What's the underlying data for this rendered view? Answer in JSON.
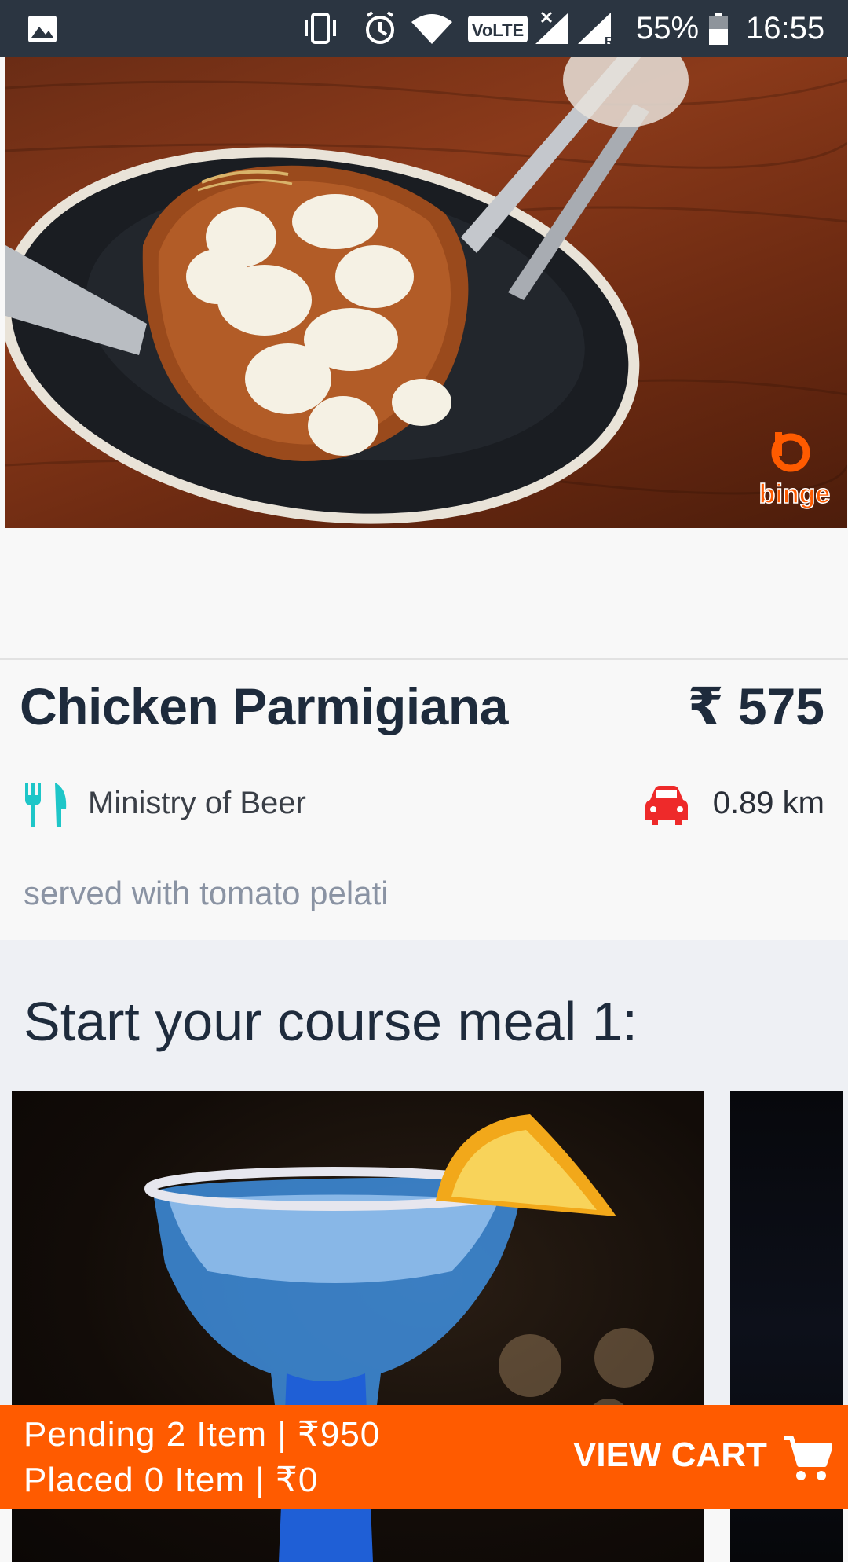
{
  "status_bar": {
    "battery_percent": "55%",
    "time": "16:55",
    "network_label": "VoLTE",
    "icons": [
      "gallery-icon",
      "vibrate-icon",
      "alarm-icon",
      "wifi-icon",
      "volte-icon",
      "signal-icon",
      "signal-roaming-icon",
      "battery-icon"
    ]
  },
  "hero": {
    "image": "chicken-parmigiana-photo",
    "watermark_text": "binge"
  },
  "dish": {
    "title": "Chicken Parmigiana",
    "price": "₹ 575",
    "restaurant": "Ministry of Beer",
    "distance": "0.89 km",
    "description": "served with tomato pelati",
    "icons": {
      "restaurant": "cutlery-icon",
      "distance": "car-icon"
    },
    "colors": {
      "cutlery": "#1ec6c8",
      "car": "#ee2a2a"
    }
  },
  "course": {
    "heading": "Start your course meal 1:",
    "cards": [
      {
        "image": "blue-cocktail-photo"
      },
      {
        "image": "dark-drink-photo"
      }
    ]
  },
  "cart": {
    "pending": "Pending 2 Item | ₹950",
    "placed": "Placed 0 Item | ₹0",
    "button_label": "VIEW CART",
    "icon": "cart-icon",
    "color": "#ff5b00"
  }
}
